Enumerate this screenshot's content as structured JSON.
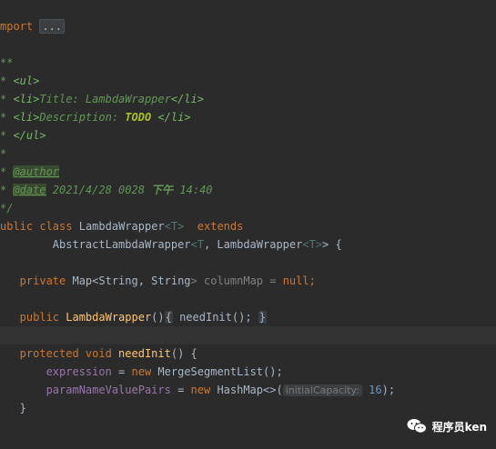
{
  "editor": {
    "l1": {
      "kw": "mport",
      "fold": "..."
    },
    "l2": {
      "text": "**"
    },
    "l3": {
      "star": "* ",
      "tag": "<ul>"
    },
    "l4": {
      "star": "* ",
      "open": "<li>",
      "text": "Title: LambdaWrapper",
      "close": "</li>"
    },
    "l5": {
      "star": "* ",
      "open": "<li>",
      "text": "Description: ",
      "todo": "TODO",
      "close": " </li>"
    },
    "l6": {
      "star": "* ",
      "tag": "</ul>"
    },
    "l7": {
      "text": "*"
    },
    "l8": {
      "star": "* ",
      "tag": "@author"
    },
    "l9": {
      "star": "* ",
      "tag": "@date",
      "text": " 2021/4/28 0028 ",
      "bold": "下午",
      "text2": " 14:40"
    },
    "l10": {
      "text": "*/"
    },
    "l11": {
      "kw1": "ublic ",
      "kw2": "class ",
      "name": "LambdaWrapper",
      "tp": "<T>",
      "kw3": "  extends"
    },
    "l12": {
      "a": "        AbstractLambdaWrapper",
      "tp1": "<T",
      "b": ", LambdaWrapper",
      "tp2": "<T>",
      "c": "> {"
    },
    "l13": {
      "kw": "   private ",
      "a": "Map<String, String",
      "tp": ">",
      "b": " columnMap = ",
      "kw2": "null",
      "c": ";"
    },
    "l14": {
      "kw": "   public ",
      "name": "LambdaWrapper",
      "a": "()",
      "fold1": "{",
      "b": " needInit(); ",
      "fold2": "}"
    },
    "l15": {
      "kw": "   protected void ",
      "name": "needInit",
      "a": "() {"
    },
    "l16": {
      "field": "       expression",
      "a": " = ",
      "kw": "new ",
      "b": "MergeSegmentList();"
    },
    "l17": {
      "field": "       paramNameValuePairs",
      "a": " = ",
      "kw": "new ",
      "b": "HashMap<>(",
      "hint": "initialCapacity:",
      "num": " 16",
      "c": ");"
    },
    "l18": {
      "text": "   }"
    }
  },
  "watermark": {
    "label": "程序员ken",
    "icon": "wechat-icon"
  }
}
